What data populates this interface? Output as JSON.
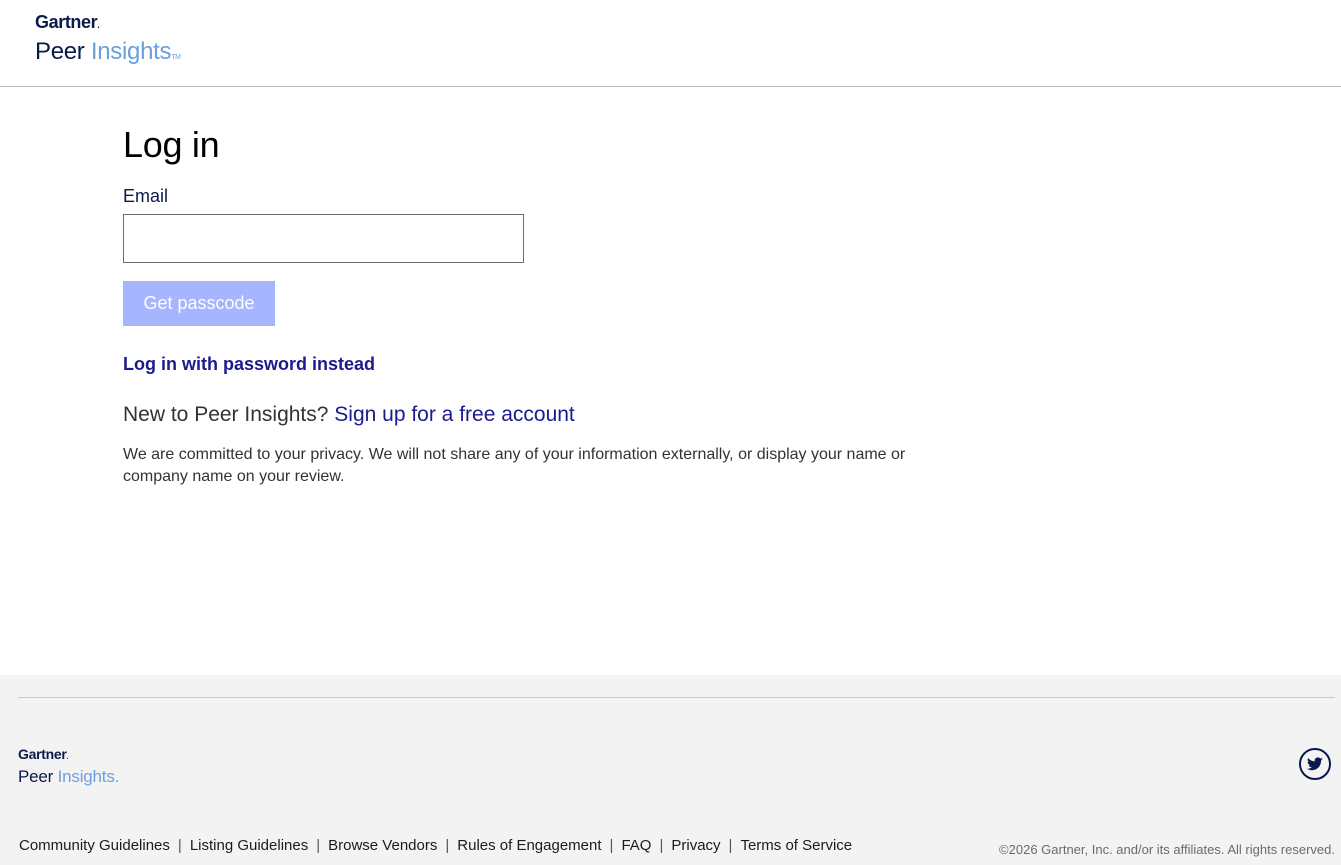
{
  "header": {
    "brand": "Gartner",
    "product_part1": "Peer ",
    "product_part2": "Insights",
    "trademark": "TM"
  },
  "login": {
    "title": "Log in",
    "email_label": "Email",
    "email_value": "",
    "email_placeholder": "",
    "passcode_button": "Get passcode",
    "password_link": "Log in with password instead",
    "signup_prompt": "New to Peer Insights?",
    "signup_link": "Sign up for a free account",
    "privacy_text": "We are committed to your privacy. We will not share any of your information externally, or display your name or company name on your review."
  },
  "footer": {
    "brand": "Gartner",
    "product_part1": "Peer ",
    "product_part2": "Insights",
    "social_icon": "twitter-icon",
    "links": [
      "Community Guidelines",
      "Listing Guidelines",
      "Browse Vendors",
      "Rules of Engagement",
      "FAQ",
      "Privacy",
      "Terms of Service"
    ],
    "separator": "|",
    "copyright": "©2026 Gartner, Inc. and/or its affiliates. All rights reserved."
  },
  "colors": {
    "brand_navy": "#0a1a4a",
    "brand_light_blue": "#6a9fe0",
    "link": "#1c1a8e",
    "button_disabled": "#a6b5fd",
    "footer_bg": "#f3f3f3"
  }
}
